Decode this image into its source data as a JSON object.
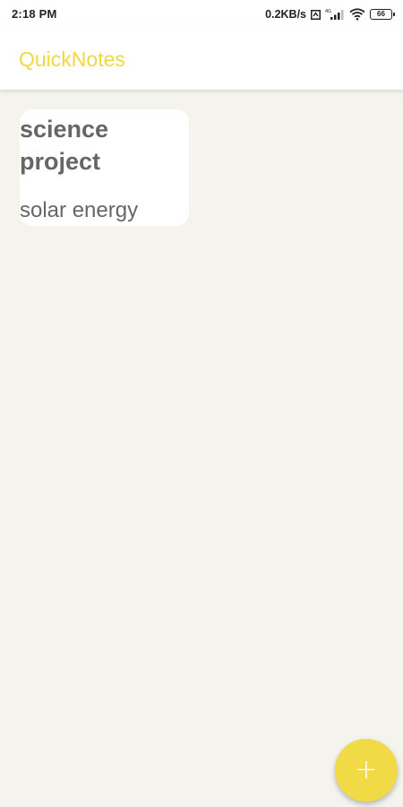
{
  "status_bar": {
    "time": "2:18 PM",
    "network_speed": "0.2KB/s",
    "battery_level": "66",
    "icons": [
      "data-saver-icon",
      "cellular-signal-icon",
      "wifi-icon",
      "battery-icon"
    ]
  },
  "app_bar": {
    "title": "QuickNotes",
    "title_color": "#f0d93e"
  },
  "notes": [
    {
      "title": "science project",
      "body": "solar energy"
    }
  ],
  "fab": {
    "icon": "plus-icon",
    "symbol": "+",
    "color": "#f0da45"
  },
  "colors": {
    "background": "#f4f3ed",
    "card": "#ffffff",
    "note_text": "#666666"
  }
}
